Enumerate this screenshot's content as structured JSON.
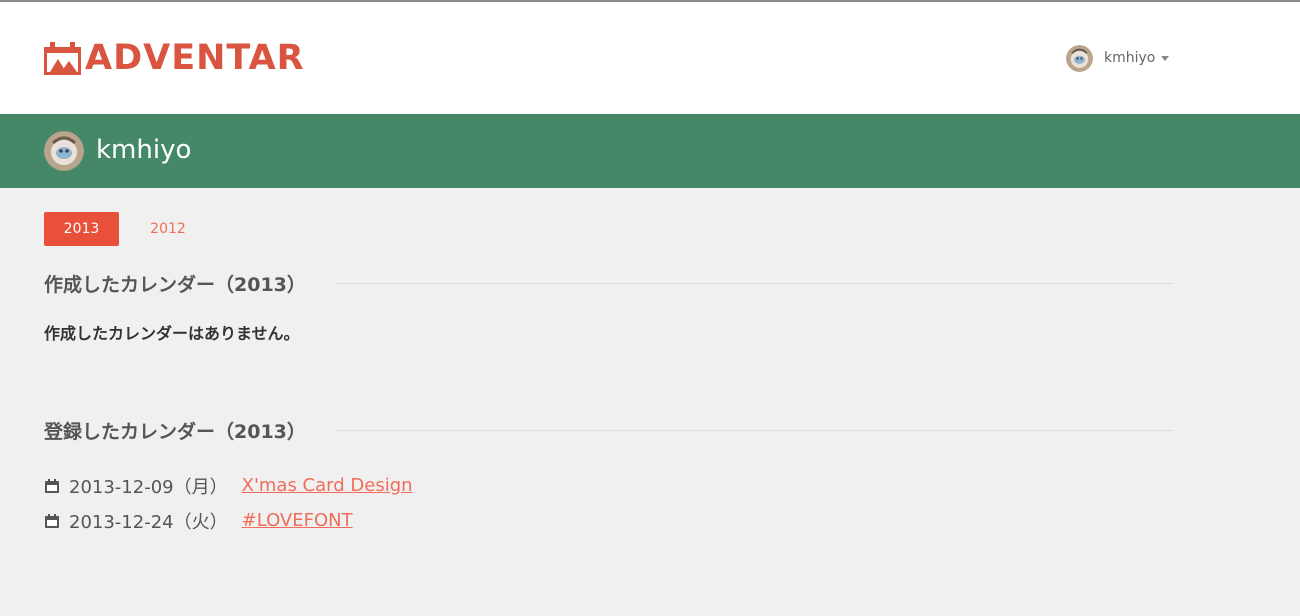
{
  "colors": {
    "brand": "#d9553f",
    "accent_tab": "#e8503a",
    "link": "#f26c5a",
    "banner": "#448867",
    "page_bg": "#f0f0f0"
  },
  "header": {
    "logo_icon": "calendar-logo-icon",
    "logo_text": "ADVENTAR",
    "user_menu": {
      "avatar_icon": "avatar-icon",
      "username": "kmhiyo",
      "caret_icon": "caret-down-icon"
    }
  },
  "banner": {
    "username": "kmhiyo"
  },
  "year_tabs": [
    {
      "label": "2013",
      "active": true
    },
    {
      "label": "2012",
      "active": false
    }
  ],
  "created_section": {
    "heading": "作成したカレンダー（2013）",
    "empty_message": "作成したカレンダーはありません。"
  },
  "registered_section": {
    "heading": "登録したカレンダー（2013）",
    "entries": [
      {
        "date": "2013-12-09（月）",
        "title": "X'mas Card Design"
      },
      {
        "date": "2013-12-24（火）",
        "title": "#LOVEFONT"
      }
    ]
  }
}
